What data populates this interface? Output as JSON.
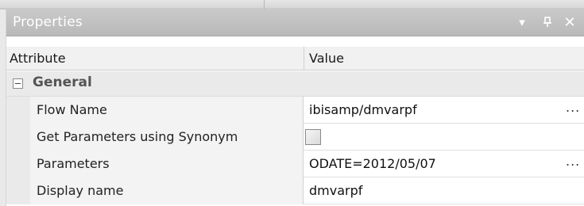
{
  "panel": {
    "title": "Properties",
    "controls": {
      "dropdown_glyph": "▾",
      "pin_glyph": "ᚨ",
      "close_glyph": "✕"
    }
  },
  "columns": {
    "attribute": "Attribute",
    "value": "Value"
  },
  "group": {
    "toggle_state": "expanded",
    "label": "General"
  },
  "rows": [
    {
      "label": "Flow Name",
      "value": "ibisamp/dmvarpf",
      "has_ellipsis": true
    },
    {
      "label": "Get Parameters using Synonym",
      "value": "",
      "checked": false
    },
    {
      "label": "Parameters",
      "value": "ODATE=2012/05/07",
      "has_ellipsis": true
    },
    {
      "label": "Display name",
      "value": "dmvarpf",
      "has_ellipsis": false
    }
  ],
  "ellipsis_glyph": "...",
  "colors": {
    "title_bar": "#c2c2c2",
    "title_text": "#ffffff",
    "attr_cell": "#f3f3f3",
    "group_row": "#eaeaea"
  }
}
